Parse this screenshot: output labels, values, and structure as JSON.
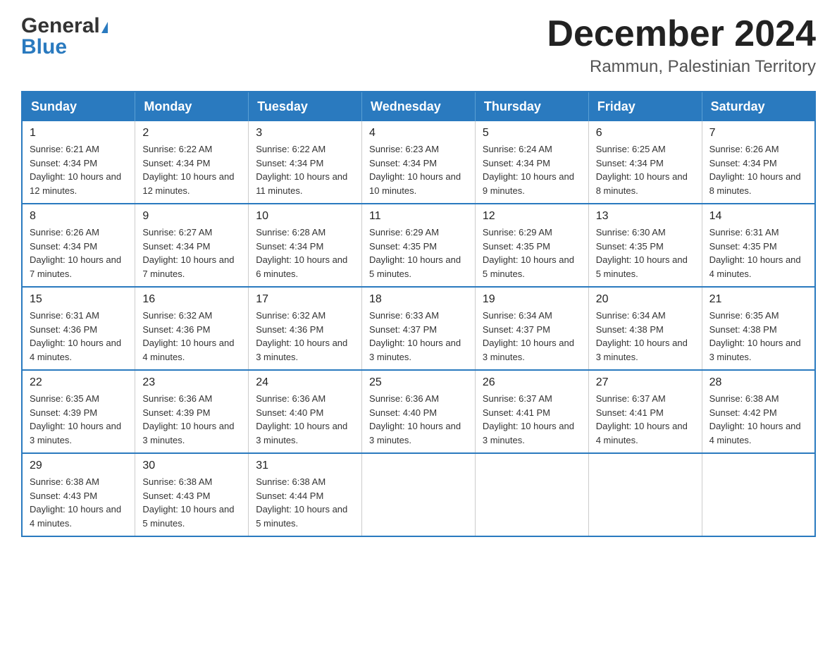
{
  "header": {
    "logo_general": "General",
    "logo_triangle": "▶",
    "logo_blue": "Blue",
    "month_year": "December 2024",
    "location": "Rammun, Palestinian Territory"
  },
  "weekdays": [
    "Sunday",
    "Monday",
    "Tuesday",
    "Wednesday",
    "Thursday",
    "Friday",
    "Saturday"
  ],
  "weeks": [
    [
      {
        "day": "1",
        "sunrise": "Sunrise: 6:21 AM",
        "sunset": "Sunset: 4:34 PM",
        "daylight": "Daylight: 10 hours and 12 minutes."
      },
      {
        "day": "2",
        "sunrise": "Sunrise: 6:22 AM",
        "sunset": "Sunset: 4:34 PM",
        "daylight": "Daylight: 10 hours and 12 minutes."
      },
      {
        "day": "3",
        "sunrise": "Sunrise: 6:22 AM",
        "sunset": "Sunset: 4:34 PM",
        "daylight": "Daylight: 10 hours and 11 minutes."
      },
      {
        "day": "4",
        "sunrise": "Sunrise: 6:23 AM",
        "sunset": "Sunset: 4:34 PM",
        "daylight": "Daylight: 10 hours and 10 minutes."
      },
      {
        "day": "5",
        "sunrise": "Sunrise: 6:24 AM",
        "sunset": "Sunset: 4:34 PM",
        "daylight": "Daylight: 10 hours and 9 minutes."
      },
      {
        "day": "6",
        "sunrise": "Sunrise: 6:25 AM",
        "sunset": "Sunset: 4:34 PM",
        "daylight": "Daylight: 10 hours and 8 minutes."
      },
      {
        "day": "7",
        "sunrise": "Sunrise: 6:26 AM",
        "sunset": "Sunset: 4:34 PM",
        "daylight": "Daylight: 10 hours and 8 minutes."
      }
    ],
    [
      {
        "day": "8",
        "sunrise": "Sunrise: 6:26 AM",
        "sunset": "Sunset: 4:34 PM",
        "daylight": "Daylight: 10 hours and 7 minutes."
      },
      {
        "day": "9",
        "sunrise": "Sunrise: 6:27 AM",
        "sunset": "Sunset: 4:34 PM",
        "daylight": "Daylight: 10 hours and 7 minutes."
      },
      {
        "day": "10",
        "sunrise": "Sunrise: 6:28 AM",
        "sunset": "Sunset: 4:34 PM",
        "daylight": "Daylight: 10 hours and 6 minutes."
      },
      {
        "day": "11",
        "sunrise": "Sunrise: 6:29 AM",
        "sunset": "Sunset: 4:35 PM",
        "daylight": "Daylight: 10 hours and 5 minutes."
      },
      {
        "day": "12",
        "sunrise": "Sunrise: 6:29 AM",
        "sunset": "Sunset: 4:35 PM",
        "daylight": "Daylight: 10 hours and 5 minutes."
      },
      {
        "day": "13",
        "sunrise": "Sunrise: 6:30 AM",
        "sunset": "Sunset: 4:35 PM",
        "daylight": "Daylight: 10 hours and 5 minutes."
      },
      {
        "day": "14",
        "sunrise": "Sunrise: 6:31 AM",
        "sunset": "Sunset: 4:35 PM",
        "daylight": "Daylight: 10 hours and 4 minutes."
      }
    ],
    [
      {
        "day": "15",
        "sunrise": "Sunrise: 6:31 AM",
        "sunset": "Sunset: 4:36 PM",
        "daylight": "Daylight: 10 hours and 4 minutes."
      },
      {
        "day": "16",
        "sunrise": "Sunrise: 6:32 AM",
        "sunset": "Sunset: 4:36 PM",
        "daylight": "Daylight: 10 hours and 4 minutes."
      },
      {
        "day": "17",
        "sunrise": "Sunrise: 6:32 AM",
        "sunset": "Sunset: 4:36 PM",
        "daylight": "Daylight: 10 hours and 3 minutes."
      },
      {
        "day": "18",
        "sunrise": "Sunrise: 6:33 AM",
        "sunset": "Sunset: 4:37 PM",
        "daylight": "Daylight: 10 hours and 3 minutes."
      },
      {
        "day": "19",
        "sunrise": "Sunrise: 6:34 AM",
        "sunset": "Sunset: 4:37 PM",
        "daylight": "Daylight: 10 hours and 3 minutes."
      },
      {
        "day": "20",
        "sunrise": "Sunrise: 6:34 AM",
        "sunset": "Sunset: 4:38 PM",
        "daylight": "Daylight: 10 hours and 3 minutes."
      },
      {
        "day": "21",
        "sunrise": "Sunrise: 6:35 AM",
        "sunset": "Sunset: 4:38 PM",
        "daylight": "Daylight: 10 hours and 3 minutes."
      }
    ],
    [
      {
        "day": "22",
        "sunrise": "Sunrise: 6:35 AM",
        "sunset": "Sunset: 4:39 PM",
        "daylight": "Daylight: 10 hours and 3 minutes."
      },
      {
        "day": "23",
        "sunrise": "Sunrise: 6:36 AM",
        "sunset": "Sunset: 4:39 PM",
        "daylight": "Daylight: 10 hours and 3 minutes."
      },
      {
        "day": "24",
        "sunrise": "Sunrise: 6:36 AM",
        "sunset": "Sunset: 4:40 PM",
        "daylight": "Daylight: 10 hours and 3 minutes."
      },
      {
        "day": "25",
        "sunrise": "Sunrise: 6:36 AM",
        "sunset": "Sunset: 4:40 PM",
        "daylight": "Daylight: 10 hours and 3 minutes."
      },
      {
        "day": "26",
        "sunrise": "Sunrise: 6:37 AM",
        "sunset": "Sunset: 4:41 PM",
        "daylight": "Daylight: 10 hours and 3 minutes."
      },
      {
        "day": "27",
        "sunrise": "Sunrise: 6:37 AM",
        "sunset": "Sunset: 4:41 PM",
        "daylight": "Daylight: 10 hours and 4 minutes."
      },
      {
        "day": "28",
        "sunrise": "Sunrise: 6:38 AM",
        "sunset": "Sunset: 4:42 PM",
        "daylight": "Daylight: 10 hours and 4 minutes."
      }
    ],
    [
      {
        "day": "29",
        "sunrise": "Sunrise: 6:38 AM",
        "sunset": "Sunset: 4:43 PM",
        "daylight": "Daylight: 10 hours and 4 minutes."
      },
      {
        "day": "30",
        "sunrise": "Sunrise: 6:38 AM",
        "sunset": "Sunset: 4:43 PM",
        "daylight": "Daylight: 10 hours and 5 minutes."
      },
      {
        "day": "31",
        "sunrise": "Sunrise: 6:38 AM",
        "sunset": "Sunset: 4:44 PM",
        "daylight": "Daylight: 10 hours and 5 minutes."
      },
      null,
      null,
      null,
      null
    ]
  ]
}
